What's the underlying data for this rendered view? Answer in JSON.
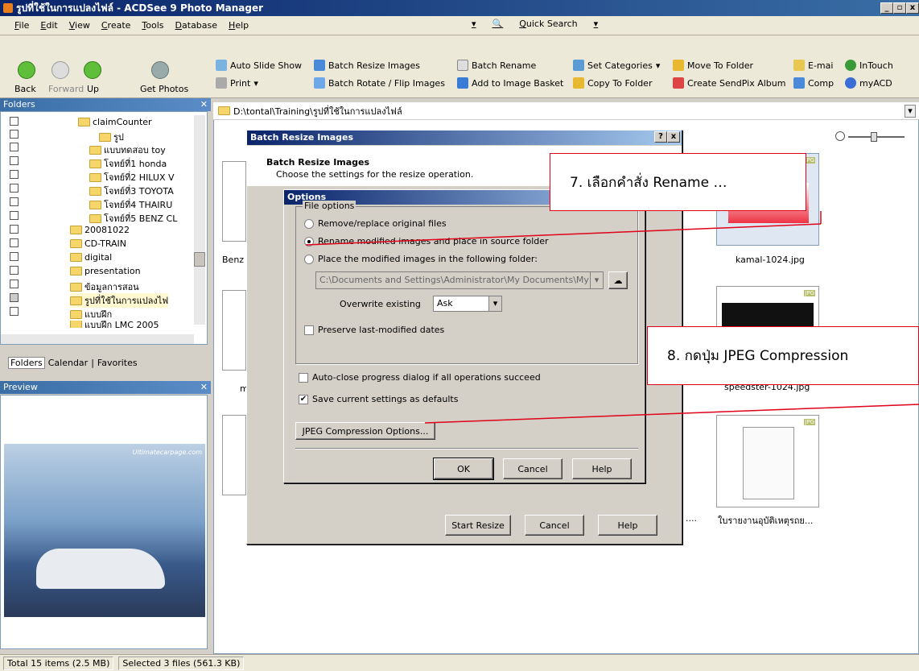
{
  "window": {
    "title": "รูปที่ใช้ในการแปลงไฟล์ - ACDSee 9 Photo Manager",
    "min": "_",
    "max": "▫",
    "close": "x"
  },
  "menu": [
    "File",
    "Edit",
    "View",
    "Create",
    "Tools",
    "Database",
    "Help"
  ],
  "quick_search": "Quick Search",
  "toolbar": {
    "back": "Back",
    "forward": "Forward",
    "up": "Up",
    "get_photos": "Get Photos",
    "auto_slide_show": "Auto Slide Show",
    "print": "Print",
    "batch_resize": "Batch Resize Images",
    "batch_rotate": "Batch Rotate / Flip Images",
    "batch_rename": "Batch Rename",
    "add_basket": "Add to Image Basket",
    "set_categories": "Set Categories",
    "copy_folder": "Copy To Folder",
    "move_folder": "Move To Folder",
    "sendpix": "Create SendPix Album",
    "email": "E-mai",
    "comp": "Comp",
    "intouch": "InTouch",
    "myacd": "myACD"
  },
  "folders": {
    "header": "Folders",
    "items": [
      "claimCounter",
      "รูป",
      "แบบทดสอบ toy",
      "โจทย์ที่1 honda",
      "โจทย์ที่2 HILUX V",
      "โจทย์ที่3 TOYOTA",
      "โจทย์ที่4 THAIRU",
      "โจทย์ที่5 BENZ CL",
      "20081022",
      "CD-TRAIN",
      "digital",
      "presentation",
      "ข้อมูลการสอน",
      "รูปที่ใช้ในการแปลงไฟ",
      "แบบฝึก",
      "แบบฝึก LMC 2005"
    ],
    "tabs": [
      "Folders",
      "Calendar",
      "Favorites"
    ]
  },
  "preview": {
    "header": "Preview",
    "watermark": "Ultimatecarpage.com"
  },
  "path": "D:\\tontal\\Training\\รูปที่ใช้ในการแปลงไฟล์",
  "files": {
    "kamal": "kamal-1024.jpg",
    "speedster": "speedster-1024.jpg",
    "report": "ใบรายงานอุบัติเหตุรถย...",
    "benz": "Benz",
    "m": "m",
    "dots": "....",
    "jpg_tag": "JPG"
  },
  "batch_dialog": {
    "title": "Batch Resize Images",
    "help": "?",
    "close": "x",
    "heading": "Batch Resize Images",
    "subheading": "Choose the settings for the resize operation.",
    "start": "Start Resize",
    "cancel": "Cancel",
    "help_btn": "Help"
  },
  "options_dialog": {
    "title": "Options",
    "group": "File options",
    "opt1": "Remove/replace original files",
    "opt2": "Rename modified images and place in source folder",
    "opt3": "Place the modified images in the following folder:",
    "folder_path": "C:\\Documents and Settings\\Administrator\\My Documents\\My",
    "overwrite_label": "Overwrite existing",
    "overwrite_value": "Ask",
    "preserve": "Preserve last-modified dates",
    "autoclose": "Auto-close progress dialog if all operations succeed",
    "save_defaults": "Save current settings as defaults",
    "jpeg_btn": "JPEG Compression Options...",
    "ok": "OK",
    "cancel": "Cancel",
    "help": "Help"
  },
  "annotations": {
    "step7": "7. เลือกคำสั่ง Rename …",
    "step8": "8. กดปุ่ม JPEG Compression"
  },
  "status": {
    "total": "Total 15 items  (2.5 MB)",
    "selected": "Selected 3 files (561.3 KB)"
  },
  "colors": {
    "accent": "#0a246a",
    "annotation_border": "#e0001a"
  }
}
